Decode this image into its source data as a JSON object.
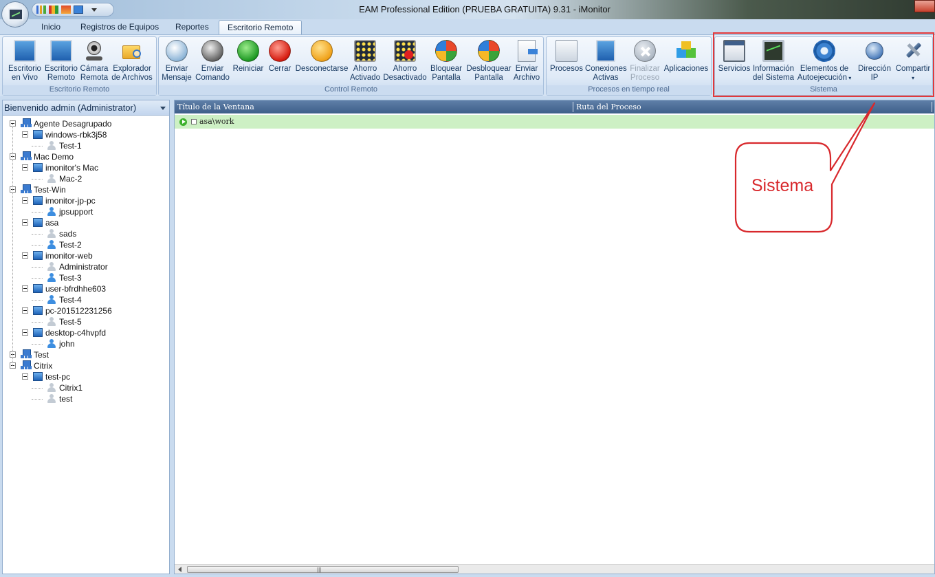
{
  "window": {
    "title": "EAM Professional Edition (PRUEBA GRATUITA) 9.31 - iMonitor"
  },
  "tabs": [
    {
      "label": "Inicio"
    },
    {
      "label": "Registros de Equipos"
    },
    {
      "label": "Reportes"
    },
    {
      "label": "Escritorio Remoto",
      "active": true
    }
  ],
  "ribbon": {
    "groups": {
      "escritorio_remoto": {
        "label": "Escritorio Remoto",
        "buttons": [
          {
            "line1": "Escritorio",
            "line2": "en Vivo",
            "icon": "live-desktop-icon"
          },
          {
            "line1": "Escritorio",
            "line2": "Remoto",
            "icon": "remote-desktop-icon"
          },
          {
            "line1": "Cámara",
            "line2": "Remota",
            "icon": "webcam-icon"
          },
          {
            "line1": "Explorador",
            "line2": "de Archivos",
            "icon": "folder-search-icon"
          }
        ]
      },
      "control_remoto": {
        "label": "Control Remoto",
        "buttons": [
          {
            "line1": "Enviar",
            "line2": "Mensaje",
            "icon": "message-icon"
          },
          {
            "line1": "Enviar",
            "line2": "Comando",
            "icon": "command-icon"
          },
          {
            "line1": "Reiniciar",
            "line2": "",
            "icon": "restart-icon"
          },
          {
            "line1": "Cerrar",
            "line2": "",
            "icon": "power-icon"
          },
          {
            "line1": "Desconectarse",
            "line2": "",
            "icon": "key-icon"
          },
          {
            "line1": "Ahorro",
            "line2": "Activado",
            "icon": "screensaver-on-icon"
          },
          {
            "line1": "Ahorro",
            "line2": "Desactivado",
            "icon": "screensaver-off-icon"
          },
          {
            "line1": "Bloquear",
            "line2": "Pantalla",
            "icon": "lock-screen-icon"
          },
          {
            "line1": "Desbloquear",
            "line2": "Pantalla",
            "icon": "unlock-screen-icon"
          },
          {
            "line1": "Enviar",
            "line2": "Archivo",
            "icon": "send-file-icon"
          }
        ]
      },
      "procesos": {
        "label": "Procesos en tiempo real",
        "buttons": [
          {
            "line1": "Procesos",
            "line2": "",
            "icon": "processes-icon"
          },
          {
            "line1": "Conexiones",
            "line2": "Activas",
            "icon": "network-icon"
          },
          {
            "line1": "Finalizar",
            "line2": "Proceso",
            "icon": "end-process-icon",
            "disabled": true
          },
          {
            "line1": "Aplicaciones",
            "line2": "",
            "icon": "applications-icon"
          }
        ]
      },
      "sistema": {
        "label": "Sistema",
        "buttons": [
          {
            "line1": "Servicios",
            "line2": "",
            "icon": "services-icon"
          },
          {
            "line1": "Información",
            "line2": "del Sistema",
            "icon": "system-info-icon"
          },
          {
            "line1": "Elementos de",
            "line2": "Autoejecución",
            "icon": "gear-icon",
            "dropdown": true
          },
          {
            "line1": "Dirección",
            "line2": "IP",
            "icon": "ip-address-icon"
          },
          {
            "line1": "Compartir",
            "line2": "",
            "icon": "share-icon",
            "dropdown": true
          }
        ]
      }
    }
  },
  "left_panel": {
    "header": "Bienvenido admin (Administrator)",
    "tree": [
      {
        "label": "Agente Desagrupado",
        "type": "group",
        "level": 0
      },
      {
        "label": "windows-rbk3j58",
        "type": "pc",
        "level": 1
      },
      {
        "label": "Test-1",
        "type": "user",
        "level": 2,
        "online": false
      },
      {
        "label": "Mac Demo",
        "type": "group",
        "level": 0
      },
      {
        "label": "imonitor's Mac",
        "type": "pc",
        "level": 1
      },
      {
        "label": "Mac-2",
        "type": "user",
        "level": 2,
        "online": false
      },
      {
        "label": "Test-Win",
        "type": "group",
        "level": 0
      },
      {
        "label": "imonitor-jp-pc",
        "type": "pc",
        "level": 1
      },
      {
        "label": "jpsupport",
        "type": "user",
        "level": 2,
        "online": true
      },
      {
        "label": "asa",
        "type": "pc",
        "level": 1
      },
      {
        "label": "sads",
        "type": "user",
        "level": 2,
        "online": false
      },
      {
        "label": "Test-2",
        "type": "user",
        "level": 2,
        "online": true
      },
      {
        "label": "imonitor-web",
        "type": "pc",
        "level": 1
      },
      {
        "label": "Administrator",
        "type": "user",
        "level": 2,
        "online": false
      },
      {
        "label": "Test-3",
        "type": "user",
        "level": 2,
        "online": true
      },
      {
        "label": "user-bfrdhhe603",
        "type": "pc",
        "level": 1
      },
      {
        "label": "Test-4",
        "type": "user",
        "level": 2,
        "online": true
      },
      {
        "label": "pc-201512231256",
        "type": "pc",
        "level": 1
      },
      {
        "label": "Test-5",
        "type": "user",
        "level": 2,
        "online": false
      },
      {
        "label": "desktop-c4hvpfd",
        "type": "pc",
        "level": 1
      },
      {
        "label": "john",
        "type": "user",
        "level": 2,
        "online": true
      },
      {
        "label": "Test",
        "type": "group",
        "level": 0
      },
      {
        "label": "Citrix",
        "type": "group",
        "level": 0
      },
      {
        "label": "test-pc",
        "type": "pc",
        "level": 1
      },
      {
        "label": "Citrix1",
        "type": "user",
        "level": 2,
        "online": false
      },
      {
        "label": "test",
        "type": "user",
        "level": 2,
        "online": false
      }
    ]
  },
  "main_panel": {
    "columns": [
      "Título de la Ventana",
      "Ruta del Proceso"
    ],
    "rows": [
      {
        "title": "asa\\work",
        "path": ""
      }
    ]
  },
  "annotation": {
    "callout_text": "Sistema"
  },
  "colors": {
    "highlight_red": "#e2383b",
    "row_green": "#cdf0c4",
    "header_blue": "#4a6a94"
  }
}
